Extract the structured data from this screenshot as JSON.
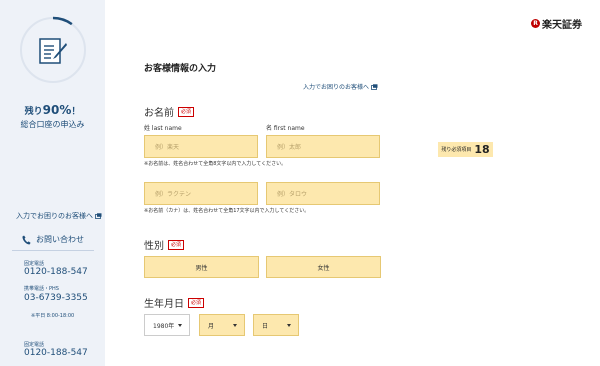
{
  "sidebar": {
    "progress": {
      "value_percent": 90,
      "prefix": "残り",
      "percent_text": "90%",
      "suffix": "！"
    },
    "apply_label": "総合口座の申込み",
    "help_link": "入力でお困りのお客様へ",
    "contact_label": "お問い合わせ",
    "phones": [
      {
        "label": "固定電話",
        "number": "0120-188-547"
      },
      {
        "label": "携帯電話・PHS",
        "number": "03-6739-3355"
      }
    ],
    "hours": "※平日 8:00-18:00",
    "phones_2": [
      {
        "label": "固定電話",
        "number": "0120-188-547"
      }
    ]
  },
  "header": {
    "logo_mark": "R",
    "logo_text": "楽天証券"
  },
  "form": {
    "title": "お客様情報の入力",
    "help_link": "入力でお困りのお客様へ",
    "required_tag": "必須",
    "name": {
      "label": "お名前",
      "last_label": "姓 last name",
      "first_label": "名 first name",
      "last_placeholder": "例）楽天",
      "first_placeholder": "例）太郎",
      "note": "※お名前は、姓名合わせて全角8文字以内で入力してください。",
      "kana_last_placeholder": "例）ラクテン",
      "kana_first_placeholder": "例）タロウ",
      "kana_note": "※お名前（カナ）は、姓名合わせて全角17文字以内で入力してください。"
    },
    "remaining": {
      "label": "残り必須項目",
      "count": "18"
    },
    "gender": {
      "label": "性別",
      "male": "男性",
      "female": "女性"
    },
    "birthdate": {
      "label": "生年月日",
      "year": "1980年",
      "month": "月",
      "day": "日"
    }
  },
  "colors": {
    "accent": "#1f4e79",
    "required": "#cc0000",
    "field_bg": "#fde8ae",
    "brand": "#bf0000"
  }
}
